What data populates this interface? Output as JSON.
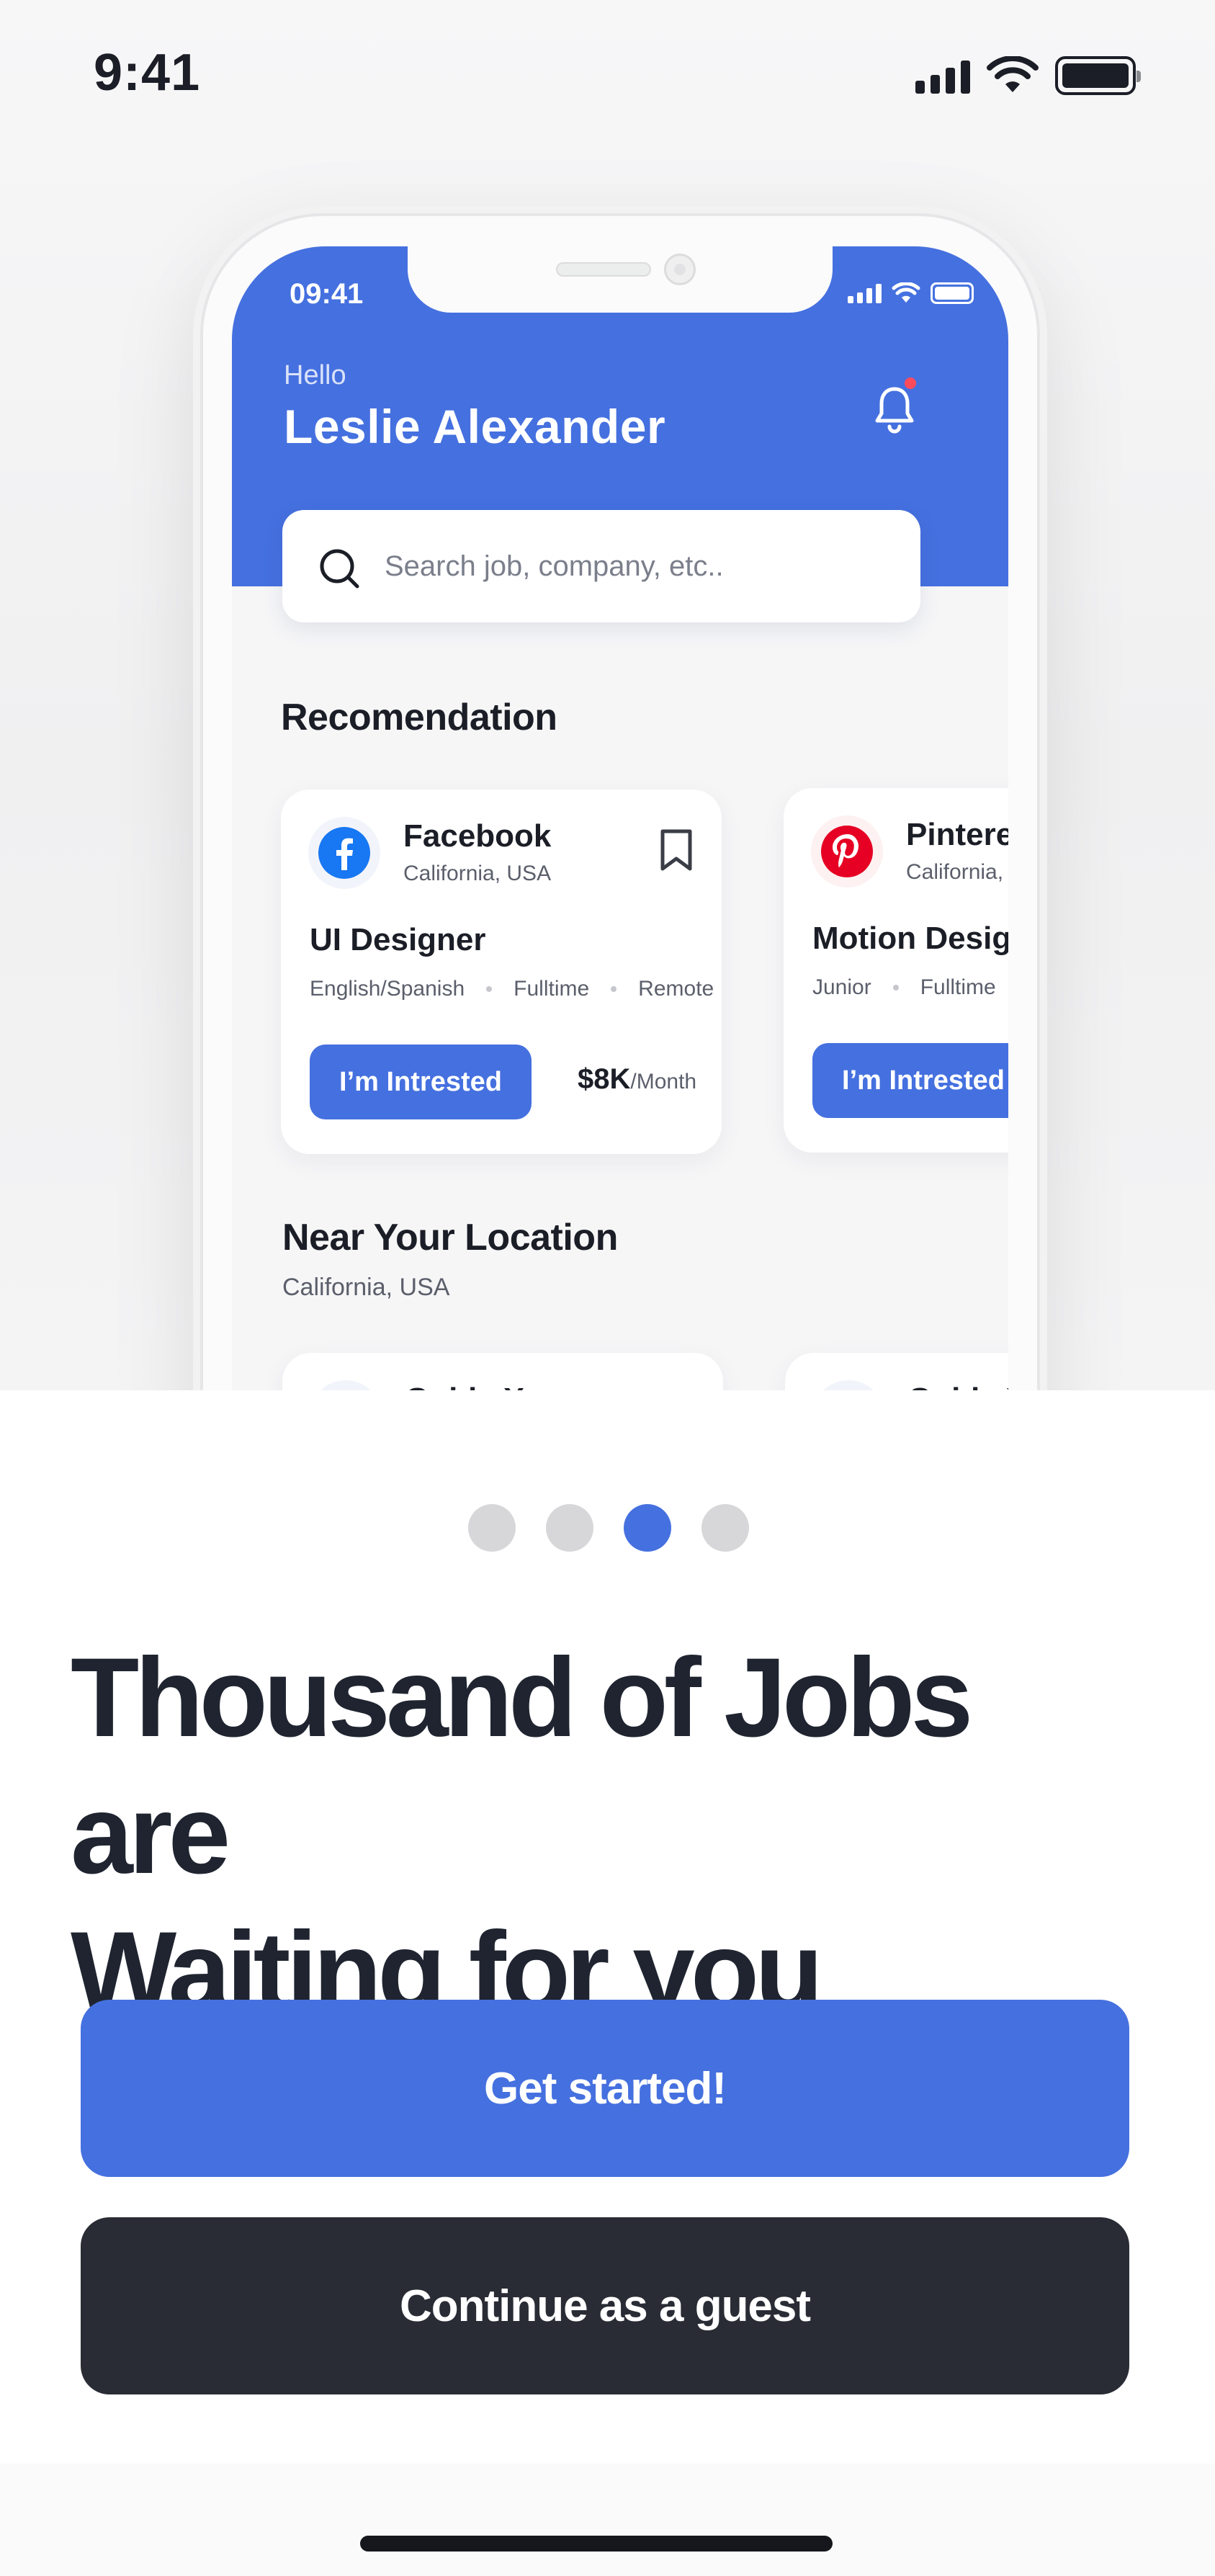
{
  "status_bar": {
    "time": "9:41"
  },
  "phone": {
    "time": "09:41",
    "greeting": "Hello",
    "user_name": "Leslie Alexander",
    "search": {
      "placeholder": "Search job, company, etc.."
    },
    "recommendation": {
      "title": "Recomendation",
      "cards": [
        {
          "company": "Facebook",
          "location": "California, USA",
          "role": "UI Designer",
          "tags": [
            "English/Spanish",
            "Fulltime",
            "Remote"
          ],
          "button": "I’m Intrested",
          "salary": "$8K",
          "salary_period": "/Month",
          "logo_icon": "facebook-icon",
          "logo_color": "#1877f2"
        },
        {
          "company": "Pinterest",
          "location": "California, USA",
          "role": "Motion Designer",
          "tags": [
            "Junior",
            "Fulltime"
          ],
          "button": "I’m Intrested",
          "logo_icon": "pinterest-icon",
          "logo_color": "#e60023"
        }
      ]
    },
    "nearby": {
      "title": "Near Your Location",
      "subtitle": "California, USA",
      "cards": [
        {
          "company": "Guide X",
          "logo_icon": "guide-x-icon"
        },
        {
          "company": "Guide X",
          "logo_icon": "guide-x-icon"
        }
      ]
    }
  },
  "onboarding": {
    "page_count": 4,
    "active_page": 3,
    "headline_line1": "Thousand of Jobs are",
    "headline_line2": "Waiting for you",
    "primary_button": "Get started!",
    "secondary_button": "Continue as a guest"
  },
  "colors": {
    "accent": "#4570df",
    "dark_button": "#292c34",
    "text_dark": "#1f2430",
    "notification_dot": "#ff4b5c"
  }
}
